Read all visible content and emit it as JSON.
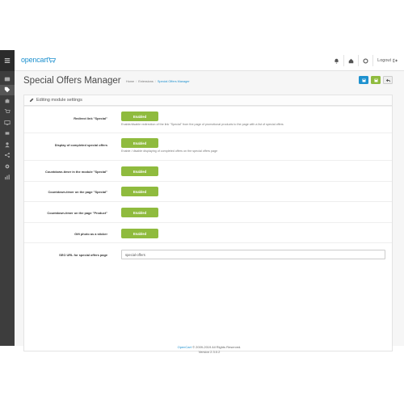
{
  "header": {
    "logo_text": "opencart",
    "logout_label": "Logout"
  },
  "page": {
    "title": "Special Offers Manager",
    "breadcrumbs": [
      "Home",
      "Extensions",
      "Special Offers Manager"
    ]
  },
  "panel": {
    "heading": "Editing module settings"
  },
  "settings": [
    {
      "label": "Redirect link \"Special\"",
      "value": "Enabled",
      "help": "Enable/disable redirection of the link \"Special\" from the page of promotional products to the page with a list of special offers"
    },
    {
      "label": "Display of completed special offers",
      "value": "Enabled",
      "help": "Enable / disable displaying of completed offers on the special offers page"
    },
    {
      "label": "Countdown-timer in the module \"Special\"",
      "value": "Enabled"
    },
    {
      "label": "Countdown-timer on the page \"Special\"",
      "value": "Enabled"
    },
    {
      "label": "Countdown-timer on the page \"Product\"",
      "value": "Enabled"
    },
    {
      "label": "Gift photo as a sticker",
      "value": "Enabled"
    }
  ],
  "seo": {
    "label": "SEO URL for special offers page",
    "value": "special-offers"
  },
  "footer": {
    "brand": "OpenCart",
    "copyright": "© 2009-2019 All Rights Reserved.",
    "version": "Version 2.3.0.2"
  },
  "colors": {
    "accent": "#1e91cf",
    "enabled": "#8fbb3e",
    "sidebar": "#3d3d3d"
  }
}
